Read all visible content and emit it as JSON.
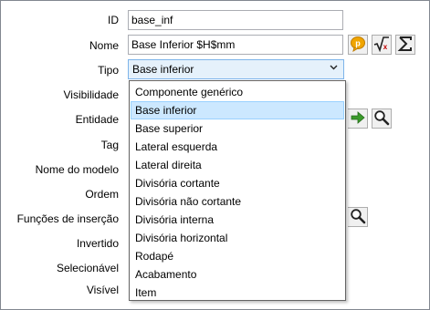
{
  "form": {
    "labels": {
      "id": "ID",
      "nome": "Nome",
      "tipo": "Tipo",
      "visibilidade": "Visibilidade",
      "entidade": "Entidade",
      "tag": "Tag",
      "nome_modelo": "Nome do modelo",
      "ordem": "Ordem",
      "funcoes_insercao": "Funções de inserção",
      "invertido": "Invertido",
      "selecionavel": "Selecionável",
      "visivel": "Visível"
    },
    "id_value": "base_inf",
    "nome_value": "Base Inferior $H$mm",
    "tipo_value": "Base inferior"
  },
  "icons": {
    "comment": "speech-bubble-icon",
    "formula": "sqrt-formula-icon",
    "sum": "sigma-icon",
    "go": "green-arrow-icon",
    "search": "magnifier-icon",
    "dropdown": "chevron-down-icon"
  },
  "dropdown": {
    "selected_index": 1,
    "options": [
      "Componente genérico",
      "Base inferior",
      "Base superior",
      "Lateral esquerda",
      "Lateral direita",
      "Divisória cortante",
      "Divisória não cortante",
      "Divisória interna",
      "Divisória horizontal",
      "Rodapé",
      "Acabamento",
      "Item"
    ]
  },
  "colors": {
    "selection_bg": "#cce8ff",
    "selection_border": "#99d1ff",
    "combo_bg": "#e5f1fb",
    "combo_border": "#7eb4ea",
    "comment_icon": "#f0a500",
    "arrow_icon": "#3a9a2a"
  }
}
